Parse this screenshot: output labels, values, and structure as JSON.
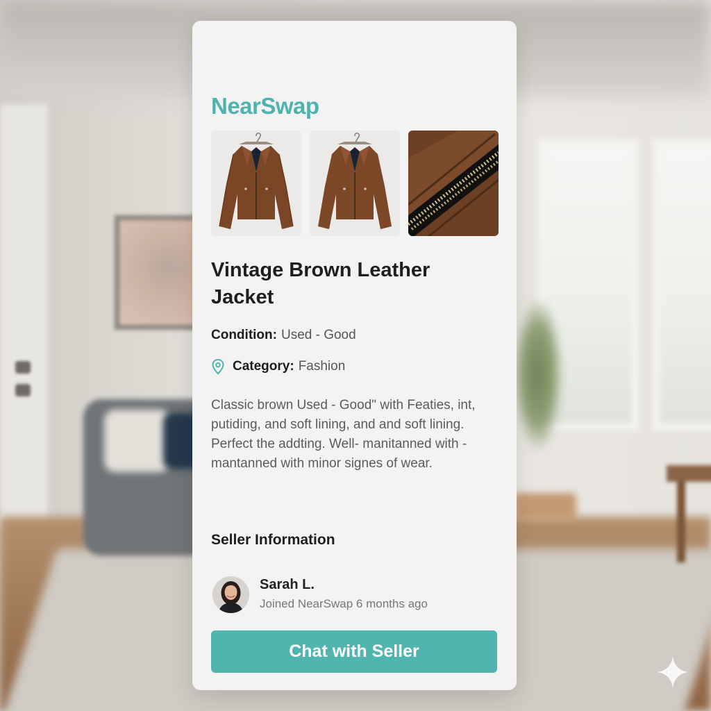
{
  "app": {
    "brand": "NearSwap"
  },
  "listing": {
    "images": [
      {
        "icon": "jacket-front-photo"
      },
      {
        "icon": "jacket-front-photo"
      },
      {
        "icon": "zipper-closeup-photo"
      }
    ],
    "title": "Vintage Brown Leather Jacket",
    "condition_label": "Condition:",
    "condition_value": "Used - Good",
    "category_label": "Category:",
    "category_value": "Fashion",
    "category_icon": "location-pin-icon",
    "description": "Classic brown Used - Good\" with Featies, int, putiding, and  soft lining, and and soft lining. Perfect the addting. Well- manitanned with -mantanned with minor signes of wear."
  },
  "seller": {
    "heading": "Seller Information",
    "name": "Sarah L.",
    "joined": "Joined NearSwap 6 months ago"
  },
  "actions": {
    "chat_button": "Chat with Seller"
  },
  "colors": {
    "accent": "#51b5af",
    "brand": "#4fb3ad",
    "card": "#f3f3f3",
    "text_primary": "#1e1e1e",
    "text_secondary": "#5b5b5b"
  }
}
